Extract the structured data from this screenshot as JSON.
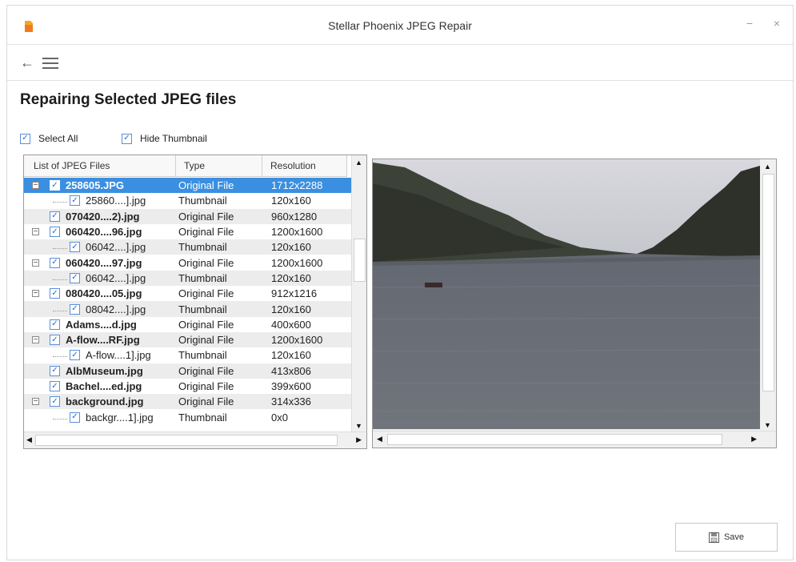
{
  "window": {
    "title": "Stellar Phoenix JPEG Repair",
    "minimize_glyph": "−",
    "close_glyph": "×"
  },
  "toolbar": {
    "back_glyph": "←"
  },
  "page": {
    "title": "Repairing Selected JPEG files"
  },
  "options": {
    "select_all": "Select All",
    "hide_thumbnail": "Hide Thumbnail"
  },
  "table": {
    "headers": [
      "List of JPEG Files",
      "Type",
      "Resolution"
    ],
    "rows": [
      {
        "level": "parent",
        "expand": "−",
        "name": "258605.JPG",
        "type": "Original File",
        "resolution": "1712x2288",
        "selected": true
      },
      {
        "level": "child",
        "expand": "",
        "name": "25860....].jpg",
        "type": "Thumbnail",
        "resolution": "120x160"
      },
      {
        "level": "parent",
        "expand": "",
        "name": "070420....2).jpg",
        "type": "Original File",
        "resolution": "960x1280"
      },
      {
        "level": "parent",
        "expand": "−",
        "name": "060420....96.jpg",
        "type": "Original File",
        "resolution": "1200x1600"
      },
      {
        "level": "child",
        "expand": "",
        "name": "06042....].jpg",
        "type": "Thumbnail",
        "resolution": "120x160"
      },
      {
        "level": "parent",
        "expand": "−",
        "name": "060420....97.jpg",
        "type": "Original File",
        "resolution": "1200x1600"
      },
      {
        "level": "child",
        "expand": "",
        "name": "06042....].jpg",
        "type": "Thumbnail",
        "resolution": "120x160"
      },
      {
        "level": "parent",
        "expand": "−",
        "name": "080420....05.jpg",
        "type": "Original File",
        "resolution": "912x1216"
      },
      {
        "level": "child",
        "expand": "",
        "name": "08042....].jpg",
        "type": "Thumbnail",
        "resolution": "120x160"
      },
      {
        "level": "parent",
        "expand": "",
        "name": "Adams....d.jpg",
        "type": "Original File",
        "resolution": "400x600"
      },
      {
        "level": "parent",
        "expand": "−",
        "name": "A-flow....RF.jpg",
        "type": "Original File",
        "resolution": "1200x1600"
      },
      {
        "level": "child",
        "expand": "",
        "name": "A-flow....1].jpg",
        "type": "Thumbnail",
        "resolution": "120x160"
      },
      {
        "level": "parent",
        "expand": "",
        "name": "AlbMuseum.jpg",
        "type": "Original File",
        "resolution": "413x806"
      },
      {
        "level": "parent",
        "expand": "",
        "name": "Bachel....ed.jpg",
        "type": "Original File",
        "resolution": "399x600"
      },
      {
        "level": "parent",
        "expand": "−",
        "name": "background.jpg",
        "type": "Original File",
        "resolution": "314x336"
      },
      {
        "level": "child",
        "expand": "",
        "name": "backgr....1].jpg",
        "type": "Thumbnail",
        "resolution": "0x0"
      }
    ]
  },
  "actions": {
    "save_label": "Save"
  },
  "colors": {
    "selection": "#3b8fe0",
    "checkbox": "#2a6acf",
    "accent_logo": "#f07b1f"
  }
}
